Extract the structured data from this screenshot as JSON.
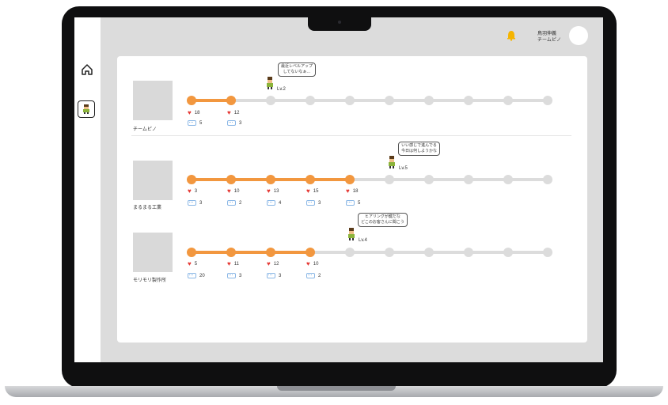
{
  "header": {
    "user_name": "鳥羽伸義",
    "team_name": "チームピノ"
  },
  "sidebar": {
    "items": [
      {
        "icon": "home-icon"
      },
      {
        "icon": "character-icon"
      }
    ]
  },
  "teams": [
    {
      "name": "チームピノ",
      "level": "Lv.2",
      "bubble": [
        "最近レベルアップ",
        "してないなぁ…"
      ],
      "completed_steps": 2,
      "hearts": [
        "18",
        "12"
      ],
      "comments": [
        "5",
        "3"
      ]
    },
    {
      "name": "まるまる工業",
      "level": "Lv.5",
      "bubble": [
        "いい感じで進んでる",
        "今日は何しようかな"
      ],
      "completed_steps": 5,
      "hearts": [
        "3",
        "10",
        "13",
        "15",
        "18"
      ],
      "comments": [
        "3",
        "2",
        "4",
        "3",
        "5"
      ]
    },
    {
      "name": "モリモリ製作所",
      "level": "Lv.4",
      "bubble": [
        "ヒアリングが鍵だな",
        "どこのお客さんに聞こう"
      ],
      "completed_steps": 4,
      "hearts": [
        "5",
        "11",
        "12",
        "10"
      ],
      "comments": [
        "20",
        "3",
        "3",
        "2"
      ]
    }
  ],
  "colors": {
    "accent": "#f2973f",
    "heart": "#e53935",
    "track": "#dcdcdc"
  }
}
